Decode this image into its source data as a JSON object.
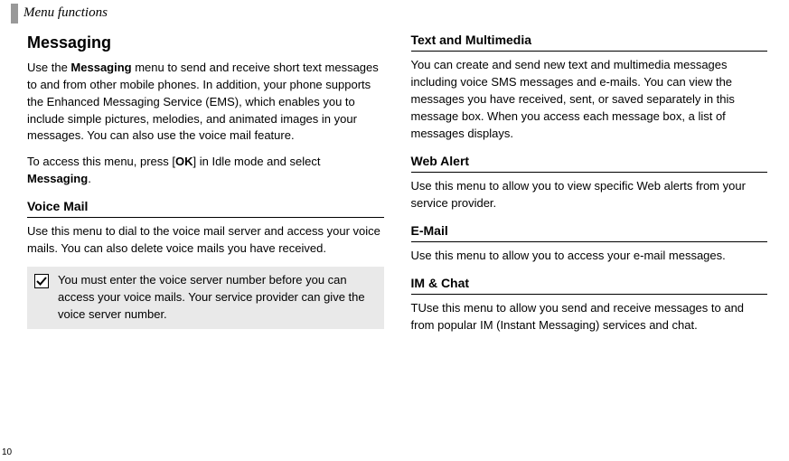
{
  "header": {
    "section": "Menu functions"
  },
  "left": {
    "h1": "Messaging",
    "p1_a": "Use the ",
    "p1_b": "Messaging",
    "p1_c": " menu to send and receive short text messages to and from other mobile phones. In addition, your phone supports the Enhanced Messaging Service (EMS), which enables you to include simple pictures, melodies, and animated images in your messages. You can also use the voice mail feature.",
    "p2_a": "To access this menu, press [",
    "p2_b": "OK",
    "p2_c": "] in Idle mode and select ",
    "p2_d": "Messaging",
    "p2_e": ".",
    "h2_voice": "Voice Mail",
    "p3": "Use this menu to dial to the voice mail server and access your voice mails. You can also delete voice mails you have received.",
    "note": "You must enter the voice server number before you can access your voice mails. Your service provider can give the voice server number."
  },
  "right": {
    "h2_text": "Text and Multimedia",
    "p_text": "You can create and send new text and multimedia messages including voice SMS messages and e-mails. You can view the messages you have received, sent, or saved separately in this message box. When you access each message box, a list of messages displays.",
    "h2_web": "Web Alert",
    "p_web": "Use this menu to allow you to view specific Web alerts from your service provider.",
    "h2_email": "E-Mail",
    "p_email": "Use this menu to allow  you to access your e-mail messages.",
    "h2_im": "IM & Chat",
    "p_im": "TUse this menu to allow you send and receive messages to and from popular IM (Instant Messaging) services and chat."
  },
  "page_number": "10"
}
